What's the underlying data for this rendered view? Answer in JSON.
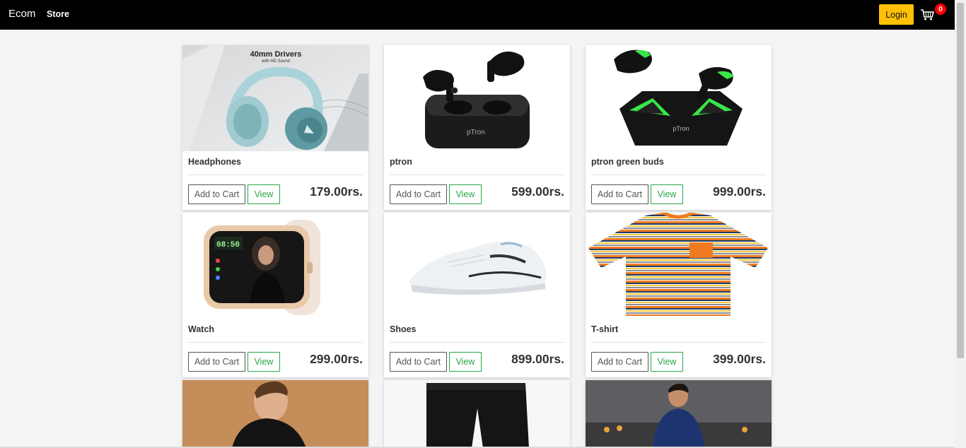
{
  "navbar": {
    "brand": "Ecom",
    "store_link": "Store",
    "login_label": "Login",
    "cart_count": "0"
  },
  "products": [
    {
      "name": "Headphones",
      "price": "179.00rs.",
      "image": "headphones"
    },
    {
      "name": "ptron",
      "price": "599.00rs.",
      "image": "black-earbuds"
    },
    {
      "name": "ptron green buds",
      "price": "999.00rs.",
      "image": "green-earbuds"
    },
    {
      "name": "Watch",
      "price": "299.00rs.",
      "image": "smartwatch"
    },
    {
      "name": "Shoes",
      "price": "899.00rs.",
      "image": "sneaker"
    },
    {
      "name": "T-shirt",
      "price": "399.00rs.",
      "image": "striped-tshirt"
    },
    {
      "image": "black-shirt-model"
    },
    {
      "image": "black-jeans"
    },
    {
      "image": "kurta-model"
    }
  ],
  "card_actions": {
    "add_to_cart": "Add to Cart",
    "view": "View"
  },
  "colors": {
    "navbar": "#000000",
    "login_button": "#ffc107",
    "cart_badge": "#ff0000",
    "view_button": "#28a745"
  }
}
